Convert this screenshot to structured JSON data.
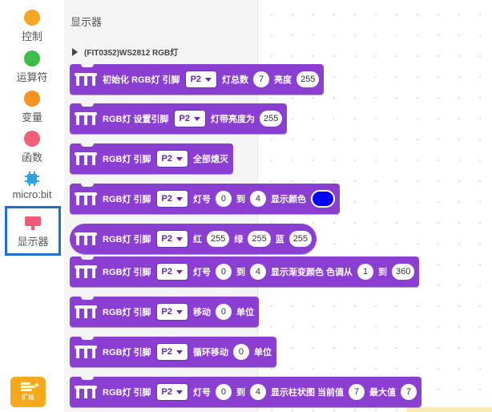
{
  "sidebar": {
    "categories": [
      {
        "label": "控制",
        "color": "#f7a823",
        "icon": "control-dot"
      },
      {
        "label": "运算符",
        "color": "#3cbd4a",
        "icon": "operators-dot"
      },
      {
        "label": "变量",
        "color": "#f7931e",
        "icon": "variables-dot"
      },
      {
        "label": "函数",
        "color": "#f25f79",
        "icon": "functions-dot"
      },
      {
        "label": "micro:bit",
        "color": "#2ea3e6",
        "icon": "chip-icon"
      },
      {
        "label": "显示器",
        "color": "#f05a79",
        "icon": "display-icon",
        "selected": true
      }
    ],
    "extension_label": "扩展"
  },
  "flyout": {
    "title": "显示器",
    "subcategory": "(FIT0352)WS2812 RGB灯"
  },
  "blocks": [
    {
      "parts": [
        {
          "t": "text",
          "v": "初始化 RGB灯 引脚"
        },
        {
          "t": "dd",
          "v": "P2"
        },
        {
          "t": "text",
          "v": "灯总数"
        },
        {
          "t": "num",
          "v": "7"
        },
        {
          "t": "text",
          "v": "亮度"
        },
        {
          "t": "num",
          "v": "255"
        }
      ]
    },
    {
      "parts": [
        {
          "t": "text",
          "v": "RGB灯 设置引脚"
        },
        {
          "t": "dd",
          "v": "P2"
        },
        {
          "t": "text",
          "v": "灯带亮度为"
        },
        {
          "t": "num",
          "v": "255"
        }
      ]
    },
    {
      "parts": [
        {
          "t": "text",
          "v": "RGB灯 引脚"
        },
        {
          "t": "dd",
          "v": "P2"
        },
        {
          "t": "text",
          "v": "全部熄灭"
        }
      ]
    },
    {
      "parts": [
        {
          "t": "text",
          "v": "RGB灯 引脚"
        },
        {
          "t": "dd",
          "v": "P2"
        },
        {
          "t": "text",
          "v": "灯号"
        },
        {
          "t": "num",
          "v": "0"
        },
        {
          "t": "text",
          "v": "到"
        },
        {
          "t": "num",
          "v": "4"
        },
        {
          "t": "text",
          "v": "显示颜色"
        },
        {
          "t": "color",
          "v": "#0000ff"
        }
      ]
    },
    {
      "round": true,
      "parts": [
        {
          "t": "text",
          "v": "RGB灯 引脚"
        },
        {
          "t": "dd",
          "v": "P2"
        },
        {
          "t": "text",
          "v": "红"
        },
        {
          "t": "num",
          "v": "255"
        },
        {
          "t": "text",
          "v": "绿"
        },
        {
          "t": "num",
          "v": "255"
        },
        {
          "t": "text",
          "v": "蓝"
        },
        {
          "t": "num",
          "v": "255"
        }
      ]
    },
    {
      "parts": [
        {
          "t": "text",
          "v": "RGB灯 引脚"
        },
        {
          "t": "dd",
          "v": "P2"
        },
        {
          "t": "text",
          "v": "灯号"
        },
        {
          "t": "num",
          "v": "0"
        },
        {
          "t": "text",
          "v": "到"
        },
        {
          "t": "num",
          "v": "4"
        },
        {
          "t": "text",
          "v": "显示渐变颜色 色调从"
        },
        {
          "t": "num",
          "v": "1"
        },
        {
          "t": "text",
          "v": "到"
        },
        {
          "t": "num",
          "v": "360"
        }
      ]
    },
    {
      "parts": [
        {
          "t": "text",
          "v": "RGB灯 引脚"
        },
        {
          "t": "dd",
          "v": "P2"
        },
        {
          "t": "text",
          "v": "移动"
        },
        {
          "t": "num",
          "v": "0"
        },
        {
          "t": "text",
          "v": "单位"
        }
      ]
    },
    {
      "parts": [
        {
          "t": "text",
          "v": "RGB灯 引脚"
        },
        {
          "t": "dd",
          "v": "P2"
        },
        {
          "t": "text",
          "v": "循环移动"
        },
        {
          "t": "num",
          "v": "0"
        },
        {
          "t": "text",
          "v": "单位"
        }
      ]
    },
    {
      "parts": [
        {
          "t": "text",
          "v": "RGB灯 引脚"
        },
        {
          "t": "dd",
          "v": "P2"
        },
        {
          "t": "text",
          "v": "灯号"
        },
        {
          "t": "num",
          "v": "0"
        },
        {
          "t": "text",
          "v": "到"
        },
        {
          "t": "num",
          "v": "4"
        },
        {
          "t": "text",
          "v": "显示柱状图 当前值"
        },
        {
          "t": "num",
          "v": "7"
        },
        {
          "t": "text",
          "v": "最大值"
        },
        {
          "t": "num",
          "v": "7"
        }
      ]
    }
  ],
  "colors": {
    "block": "#8a3fd2",
    "selection_border": "#1f6fcf",
    "extension_button": "#f6a91d"
  }
}
